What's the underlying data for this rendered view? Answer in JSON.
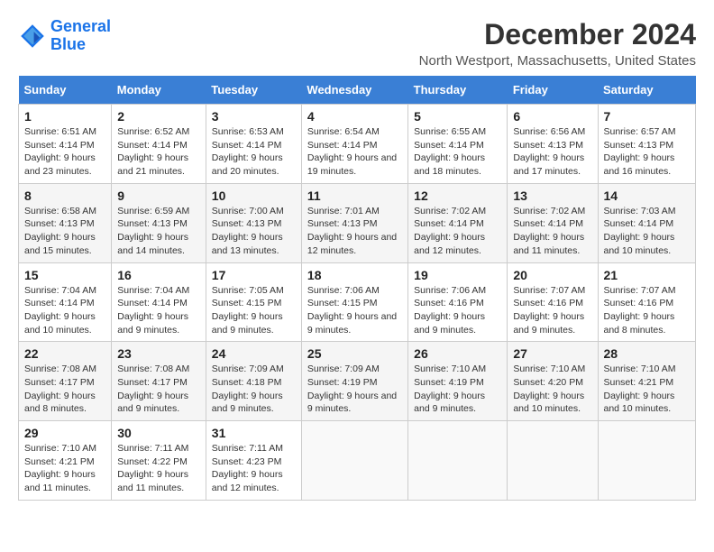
{
  "logo": {
    "line1": "General",
    "line2": "Blue"
  },
  "title": "December 2024",
  "subtitle": "North Westport, Massachusetts, United States",
  "days_header": [
    "Sunday",
    "Monday",
    "Tuesday",
    "Wednesday",
    "Thursday",
    "Friday",
    "Saturday"
  ],
  "weeks": [
    [
      {
        "day": "1",
        "sunrise": "Sunrise: 6:51 AM",
        "sunset": "Sunset: 4:14 PM",
        "daylight": "Daylight: 9 hours and 23 minutes."
      },
      {
        "day": "2",
        "sunrise": "Sunrise: 6:52 AM",
        "sunset": "Sunset: 4:14 PM",
        "daylight": "Daylight: 9 hours and 21 minutes."
      },
      {
        "day": "3",
        "sunrise": "Sunrise: 6:53 AM",
        "sunset": "Sunset: 4:14 PM",
        "daylight": "Daylight: 9 hours and 20 minutes."
      },
      {
        "day": "4",
        "sunrise": "Sunrise: 6:54 AM",
        "sunset": "Sunset: 4:14 PM",
        "daylight": "Daylight: 9 hours and 19 minutes."
      },
      {
        "day": "5",
        "sunrise": "Sunrise: 6:55 AM",
        "sunset": "Sunset: 4:14 PM",
        "daylight": "Daylight: 9 hours and 18 minutes."
      },
      {
        "day": "6",
        "sunrise": "Sunrise: 6:56 AM",
        "sunset": "Sunset: 4:13 PM",
        "daylight": "Daylight: 9 hours and 17 minutes."
      },
      {
        "day": "7",
        "sunrise": "Sunrise: 6:57 AM",
        "sunset": "Sunset: 4:13 PM",
        "daylight": "Daylight: 9 hours and 16 minutes."
      }
    ],
    [
      {
        "day": "8",
        "sunrise": "Sunrise: 6:58 AM",
        "sunset": "Sunset: 4:13 PM",
        "daylight": "Daylight: 9 hours and 15 minutes."
      },
      {
        "day": "9",
        "sunrise": "Sunrise: 6:59 AM",
        "sunset": "Sunset: 4:13 PM",
        "daylight": "Daylight: 9 hours and 14 minutes."
      },
      {
        "day": "10",
        "sunrise": "Sunrise: 7:00 AM",
        "sunset": "Sunset: 4:13 PM",
        "daylight": "Daylight: 9 hours and 13 minutes."
      },
      {
        "day": "11",
        "sunrise": "Sunrise: 7:01 AM",
        "sunset": "Sunset: 4:13 PM",
        "daylight": "Daylight: 9 hours and 12 minutes."
      },
      {
        "day": "12",
        "sunrise": "Sunrise: 7:02 AM",
        "sunset": "Sunset: 4:14 PM",
        "daylight": "Daylight: 9 hours and 12 minutes."
      },
      {
        "day": "13",
        "sunrise": "Sunrise: 7:02 AM",
        "sunset": "Sunset: 4:14 PM",
        "daylight": "Daylight: 9 hours and 11 minutes."
      },
      {
        "day": "14",
        "sunrise": "Sunrise: 7:03 AM",
        "sunset": "Sunset: 4:14 PM",
        "daylight": "Daylight: 9 hours and 10 minutes."
      }
    ],
    [
      {
        "day": "15",
        "sunrise": "Sunrise: 7:04 AM",
        "sunset": "Sunset: 4:14 PM",
        "daylight": "Daylight: 9 hours and 10 minutes."
      },
      {
        "day": "16",
        "sunrise": "Sunrise: 7:04 AM",
        "sunset": "Sunset: 4:14 PM",
        "daylight": "Daylight: 9 hours and 9 minutes."
      },
      {
        "day": "17",
        "sunrise": "Sunrise: 7:05 AM",
        "sunset": "Sunset: 4:15 PM",
        "daylight": "Daylight: 9 hours and 9 minutes."
      },
      {
        "day": "18",
        "sunrise": "Sunrise: 7:06 AM",
        "sunset": "Sunset: 4:15 PM",
        "daylight": "Daylight: 9 hours and 9 minutes."
      },
      {
        "day": "19",
        "sunrise": "Sunrise: 7:06 AM",
        "sunset": "Sunset: 4:16 PM",
        "daylight": "Daylight: 9 hours and 9 minutes."
      },
      {
        "day": "20",
        "sunrise": "Sunrise: 7:07 AM",
        "sunset": "Sunset: 4:16 PM",
        "daylight": "Daylight: 9 hours and 9 minutes."
      },
      {
        "day": "21",
        "sunrise": "Sunrise: 7:07 AM",
        "sunset": "Sunset: 4:16 PM",
        "daylight": "Daylight: 9 hours and 8 minutes."
      }
    ],
    [
      {
        "day": "22",
        "sunrise": "Sunrise: 7:08 AM",
        "sunset": "Sunset: 4:17 PM",
        "daylight": "Daylight: 9 hours and 8 minutes."
      },
      {
        "day": "23",
        "sunrise": "Sunrise: 7:08 AM",
        "sunset": "Sunset: 4:17 PM",
        "daylight": "Daylight: 9 hours and 9 minutes."
      },
      {
        "day": "24",
        "sunrise": "Sunrise: 7:09 AM",
        "sunset": "Sunset: 4:18 PM",
        "daylight": "Daylight: 9 hours and 9 minutes."
      },
      {
        "day": "25",
        "sunrise": "Sunrise: 7:09 AM",
        "sunset": "Sunset: 4:19 PM",
        "daylight": "Daylight: 9 hours and 9 minutes."
      },
      {
        "day": "26",
        "sunrise": "Sunrise: 7:10 AM",
        "sunset": "Sunset: 4:19 PM",
        "daylight": "Daylight: 9 hours and 9 minutes."
      },
      {
        "day": "27",
        "sunrise": "Sunrise: 7:10 AM",
        "sunset": "Sunset: 4:20 PM",
        "daylight": "Daylight: 9 hours and 10 minutes."
      },
      {
        "day": "28",
        "sunrise": "Sunrise: 7:10 AM",
        "sunset": "Sunset: 4:21 PM",
        "daylight": "Daylight: 9 hours and 10 minutes."
      }
    ],
    [
      {
        "day": "29",
        "sunrise": "Sunrise: 7:10 AM",
        "sunset": "Sunset: 4:21 PM",
        "daylight": "Daylight: 9 hours and 11 minutes."
      },
      {
        "day": "30",
        "sunrise": "Sunrise: 7:11 AM",
        "sunset": "Sunset: 4:22 PM",
        "daylight": "Daylight: 9 hours and 11 minutes."
      },
      {
        "day": "31",
        "sunrise": "Sunrise: 7:11 AM",
        "sunset": "Sunset: 4:23 PM",
        "daylight": "Daylight: 9 hours and 12 minutes."
      },
      null,
      null,
      null,
      null
    ]
  ]
}
